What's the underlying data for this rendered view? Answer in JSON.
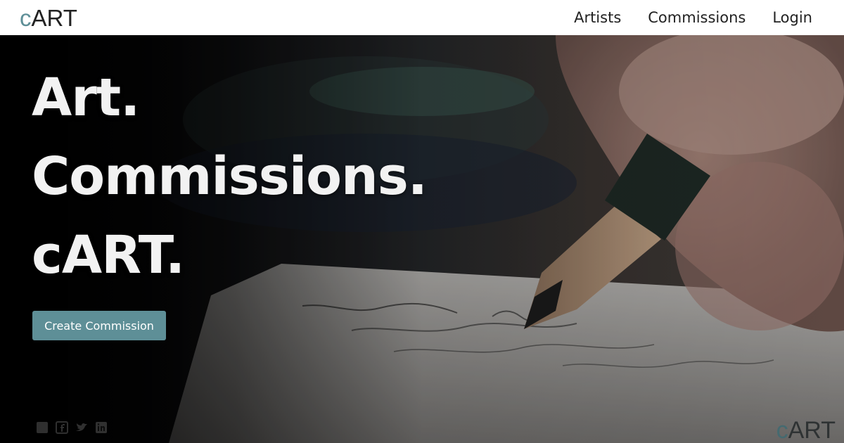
{
  "navbar": {
    "brand_prefix": "c",
    "brand_rest": "ART",
    "links": [
      {
        "label": "Artists"
      },
      {
        "label": "Commissions"
      },
      {
        "label": "Login"
      }
    ]
  },
  "hero": {
    "lines": [
      "Art.",
      "Commissions.",
      "cART."
    ],
    "cta_label": "Create Commission",
    "background": "photo-hand-drawing-with-pencil",
    "socials": [
      "facebook-icon",
      "square-facebook-icon",
      "twitter-icon",
      "linkedin-icon"
    ]
  },
  "watermark": {
    "prefix": "c",
    "rest": "ART"
  },
  "colors": {
    "accent": "#5e8f97",
    "nav_bg": "#ffffff",
    "hero_text": "#f2f2f2"
  }
}
